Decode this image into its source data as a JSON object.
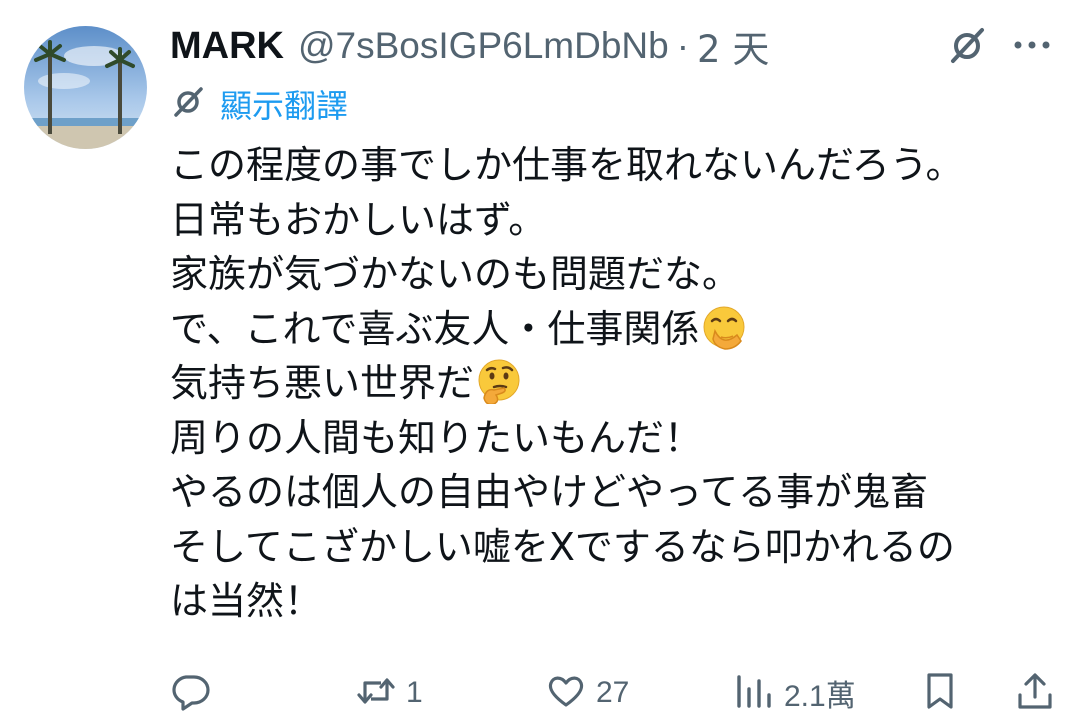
{
  "tweet": {
    "display_name": "MARK",
    "handle": "@7sBosIGP6LmDbNb",
    "separator": "·",
    "time": "2 天",
    "translate_label": "顯示翻譯",
    "lines": [
      {
        "text": "この程度の事でしか仕事を取れないんだろう。",
        "emoji": ""
      },
      {
        "text": "日常もおかしいはず。",
        "emoji": ""
      },
      {
        "text": "家族が気づかないのも問題だな。",
        "emoji": ""
      },
      {
        "text": "で、これで喜ぶ友人・仕事関係",
        "emoji": "face-with-hand-over-mouth"
      },
      {
        "text": "気持ち悪い世界だ",
        "emoji": "thinking-face"
      },
      {
        "text": "周りの人間も知りたいもんだ！",
        "emoji": ""
      },
      {
        "text": "やるのは個人の自由やけどやってる事が鬼畜",
        "emoji": ""
      },
      {
        "text": "そしてこざかしい嘘をXでするなら叩かれるの",
        "emoji": ""
      },
      {
        "text": "は当然！",
        "emoji": ""
      }
    ]
  },
  "actions": {
    "reply_count": "",
    "retweet_count": "1",
    "like_count": "27",
    "views_count": "2.1萬"
  },
  "icons": [
    "grok-icon",
    "more-icon",
    "translate-icon",
    "reply-icon",
    "retweet-icon",
    "like-icon",
    "views-icon",
    "bookmark-icon",
    "share-icon"
  ],
  "colors": {
    "text": "#0f1419",
    "secondary": "#536471",
    "link": "#1d9bf0",
    "background": "#ffffff"
  }
}
